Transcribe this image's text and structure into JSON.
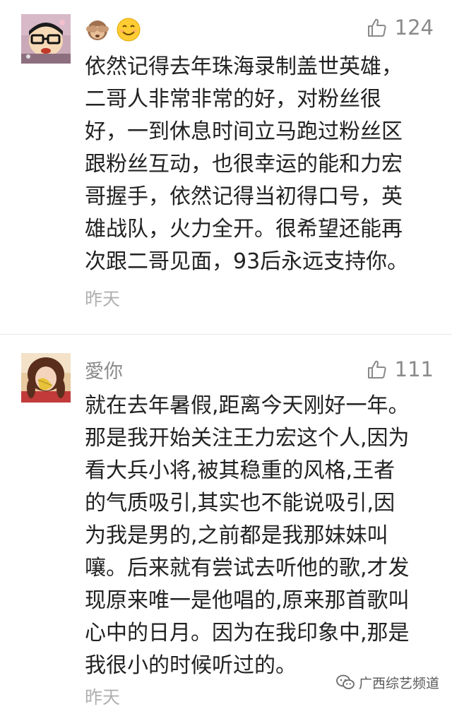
{
  "comments": [
    {
      "username": "",
      "badges": [
        "see-no-evil-monkey-emoji",
        "smiling-face-emoji"
      ],
      "likes": "124",
      "lines": [
        "依然记得去年珠海录制盖世英雄，",
        "二哥人非常非常的好，对粉丝很",
        "好，一到休息时间立马跑过粉丝区",
        "跟粉丝互动，也很幸运的能和力宏",
        "哥握手，依然记得当初得口号，英",
        "雄战队，火力全开。很希望还能再",
        "次跟二哥见面，93后永远支持你。"
      ],
      "time": "昨天"
    },
    {
      "username": "愛你",
      "likes": "111",
      "lines": [
        "就在去年暑假,距离今天刚好一年。",
        "那是我开始关注王力宏这个人,因为",
        "看大兵小将,被其稳重的风格,王者",
        "的气质吸引,其实也不能说吸引,因",
        "为我是男的,之前都是我那妹妹叫",
        "嚷。后来就有尝试去听他的歌,才发",
        "现原来唯一是他唱的,原来那首歌叫",
        "心中的日月。因为在我印象中,那是",
        "我很小的时候听过的。"
      ],
      "time": "昨天"
    }
  ],
  "watermark": {
    "text": "广西综艺频道",
    "icon": "wechat-icon"
  },
  "colors": {
    "meta_gray": "#8a8a8a",
    "time_gray": "#b0b0b0",
    "text": "#222222",
    "divider": "#e6e6e6"
  }
}
